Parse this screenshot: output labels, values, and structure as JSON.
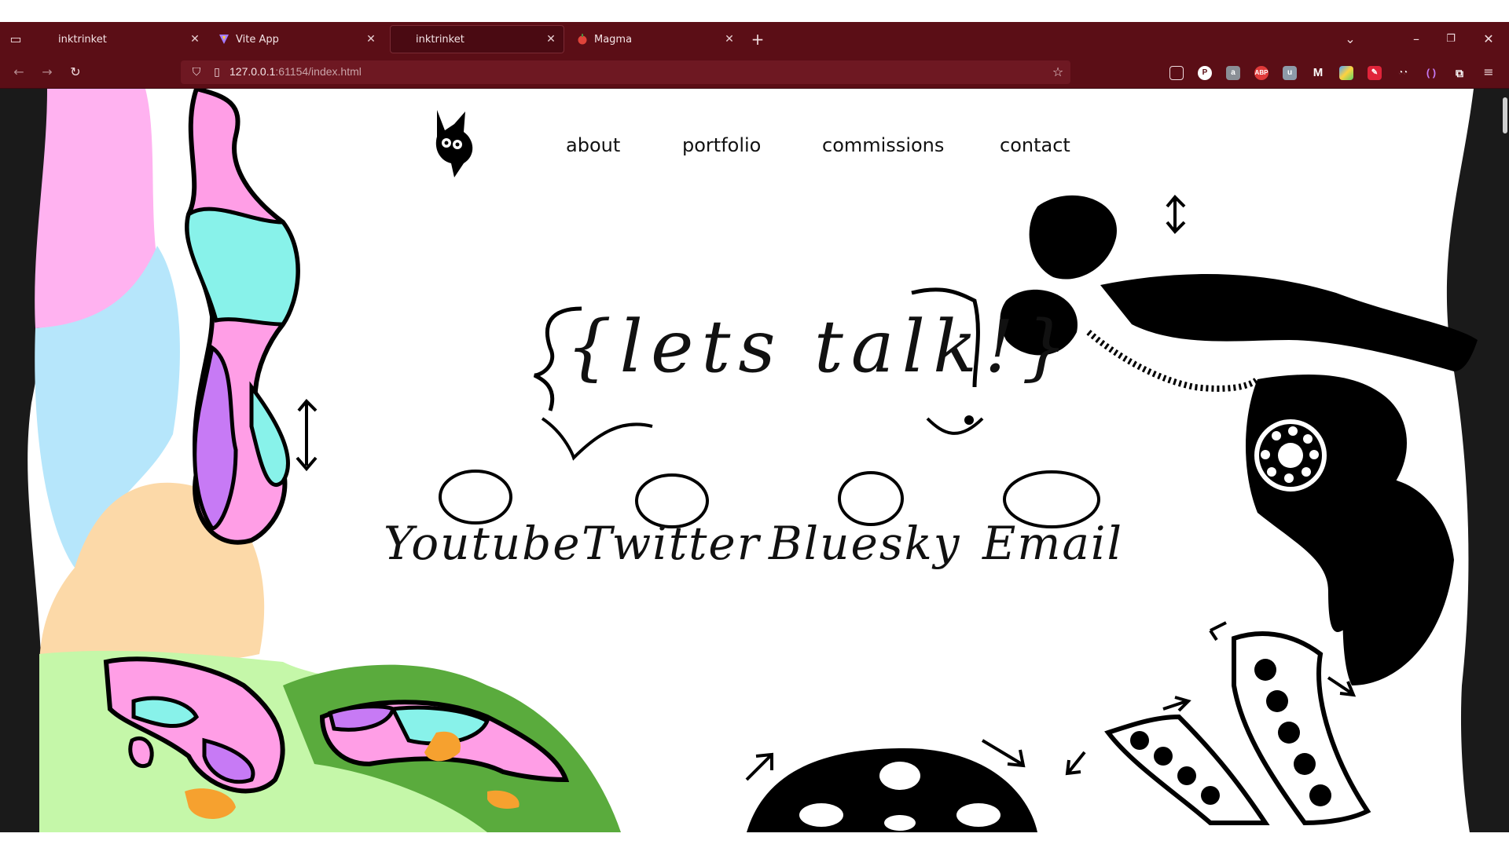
{
  "browser": {
    "tabs": [
      {
        "title": "inktrinket",
        "active": false
      },
      {
        "title": "Vite App",
        "active": false
      },
      {
        "title": "inktrinket",
        "active": true
      },
      {
        "title": "Magma",
        "active": false
      }
    ],
    "url": {
      "host": "127.0.0.1",
      "rest": ":61154/index.html"
    },
    "extensions": [
      "pocket-icon",
      "p-icon",
      "translate-icon",
      "abp-icon",
      "shield-icon",
      "m-icon",
      "color-icon",
      "pen-icon",
      "glasses-icon",
      "brackets-icon",
      "puzzle-icon"
    ]
  },
  "site": {
    "nav": {
      "about": "about",
      "portfolio": "portfolio",
      "commissions": "commissions",
      "contact": "contact"
    },
    "headline": "{lets talk!}",
    "socials": [
      {
        "label": "Youtube"
      },
      {
        "label": "Twitter"
      },
      {
        "label": "Bluesky"
      },
      {
        "label": "Email"
      }
    ]
  },
  "colors": {
    "chrome": "#5b0e16",
    "pink": "#ff9ee6",
    "cyan": "#88f2ea",
    "purple": "#c77af5",
    "peach": "#fcd9a8",
    "lightgreen": "#c5f7a9",
    "green": "#5aab3d",
    "orange": "#f6a12f",
    "lightblue": "#b6e6fb"
  }
}
